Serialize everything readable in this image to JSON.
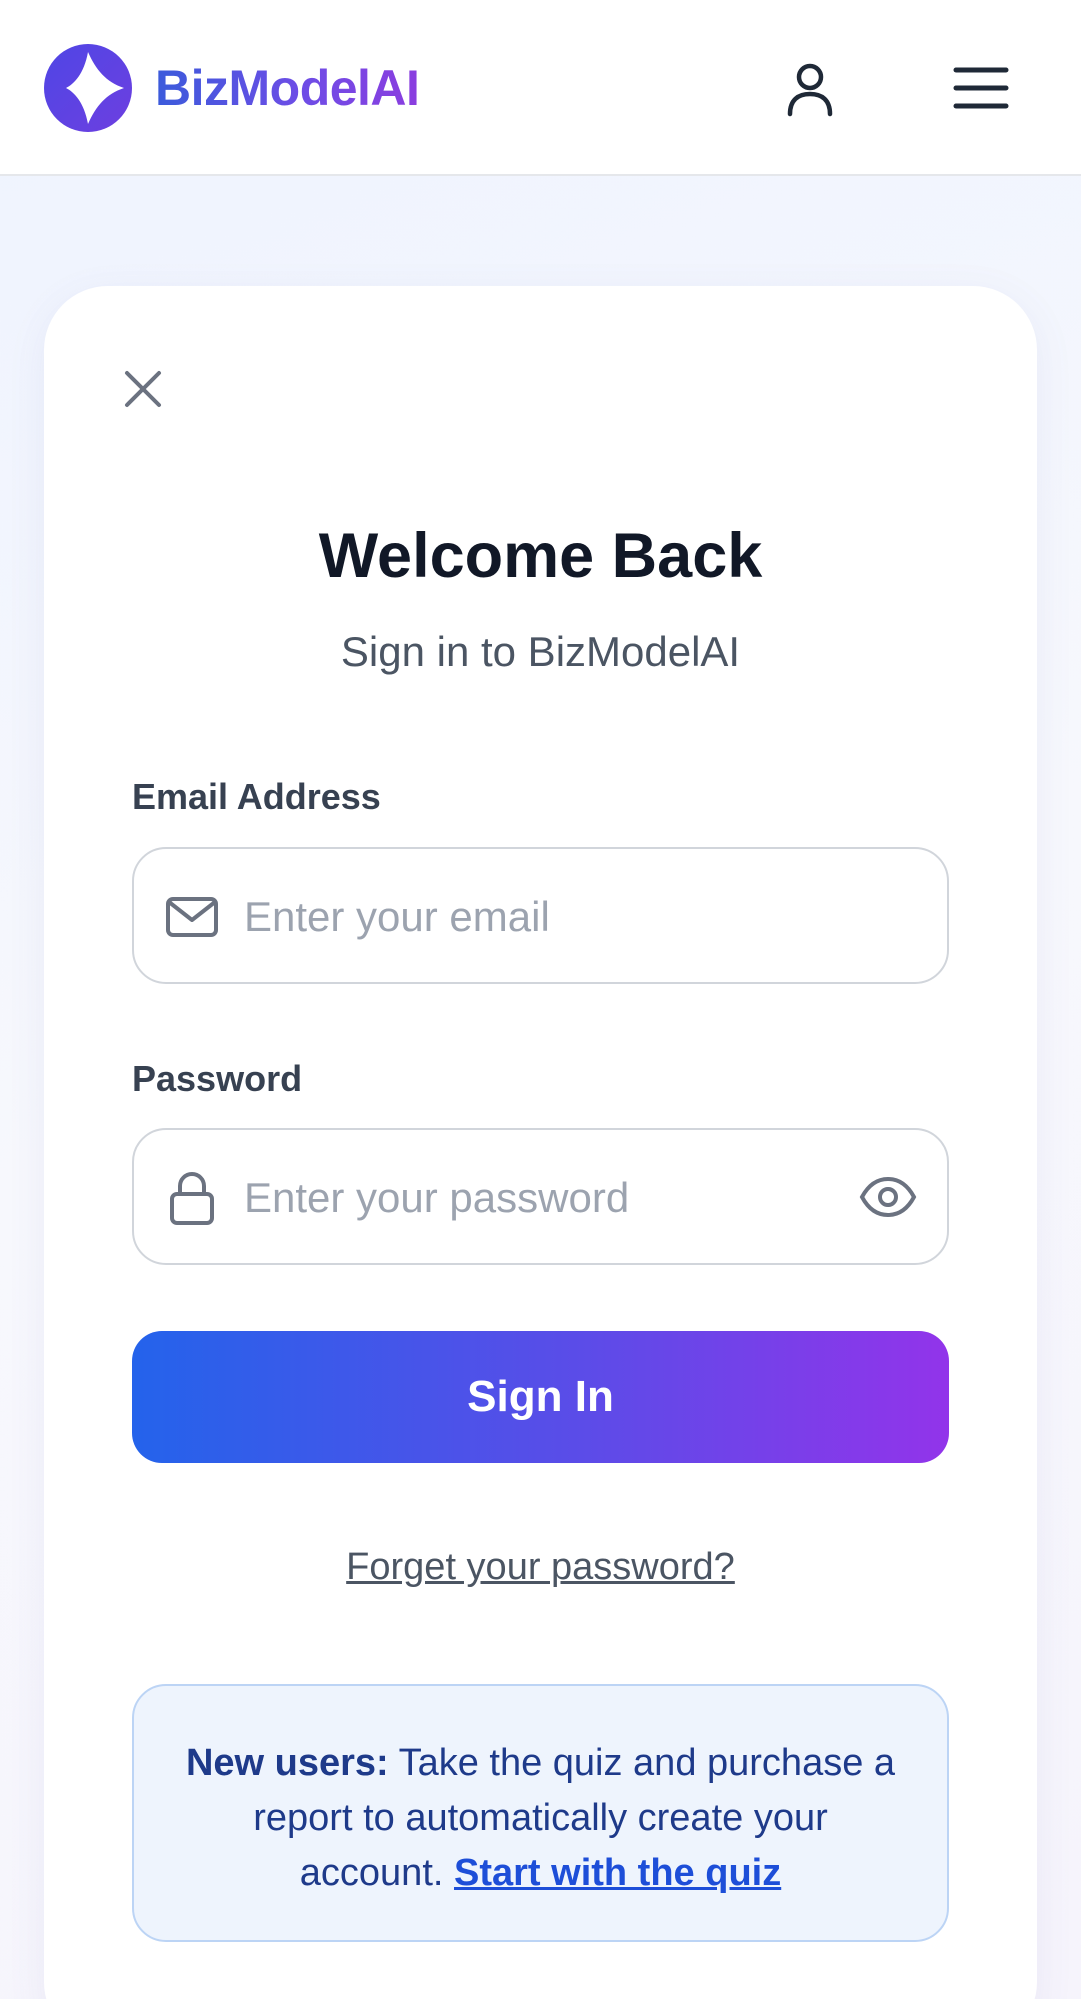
{
  "brand": {
    "name": "BizModelAI",
    "colors": {
      "primary": "#3b5bdb",
      "accent": "#9234ea"
    }
  },
  "header": {
    "logo_icon": "bizmodelai-logo",
    "user_icon": "user-icon",
    "menu_icon": "hamburger-menu-icon"
  },
  "login": {
    "close_icon": "close-icon",
    "title": "Welcome Back",
    "subtitle": "Sign in to BizModelAI",
    "email": {
      "label": "Email Address",
      "placeholder": "Enter your email",
      "value": "",
      "icon": "mail-icon"
    },
    "password": {
      "label": "Password",
      "placeholder": "Enter your password",
      "value": "",
      "icon": "lock-icon",
      "toggle_icon": "eye-icon"
    },
    "submit_label": "Sign In",
    "forgot_label": "Forget your password?"
  },
  "notice": {
    "lead": "New users:",
    "body": " Take the quiz and purchase a report to automatically create your account. ",
    "link": "Start with the quiz"
  }
}
